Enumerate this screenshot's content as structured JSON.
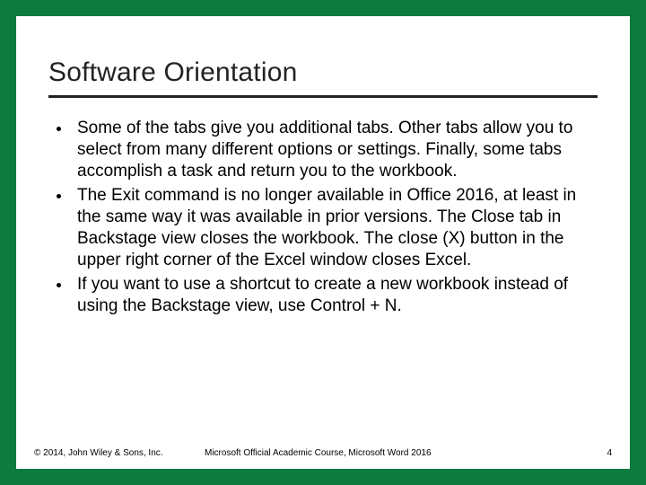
{
  "title": "Software Orientation",
  "bullets": [
    "Some of the tabs give you additional tabs. Other tabs allow you to select from many different options or settings. Finally, some tabs accomplish a task and return you to the workbook.",
    "The Exit command is no longer available in Office 2016, at least in the same way it was available in prior versions.  The Close tab in Backstage view closes the workbook.  The close (X) button in the upper right corner of the Excel window closes Excel.",
    "If you want to use a shortcut to create a new workbook instead of using the Backstage view, use Control + N."
  ],
  "footer": {
    "copyright": "© 2014, John Wiley & Sons, Inc.",
    "course": "Microsoft Official Academic Course, Microsoft Word 2016",
    "page": "4"
  }
}
